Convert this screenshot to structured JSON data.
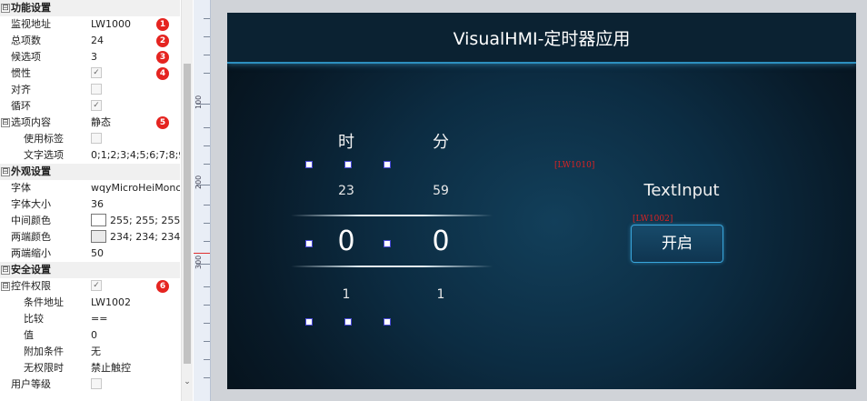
{
  "properties": {
    "sections": {
      "function": "功能设置",
      "appearance": "外观设置",
      "security": "安全设置"
    },
    "rows": {
      "monitor_address": {
        "label": "监视地址",
        "value": "LW1000",
        "badge": "1"
      },
      "total_items": {
        "label": "总项数",
        "value": "24",
        "badge": "2"
      },
      "candidate_items": {
        "label": "候选项",
        "value": "3",
        "badge": "3"
      },
      "inertia": {
        "label": "惯性",
        "checked": "✓",
        "badge": "4"
      },
      "align": {
        "label": "对齐",
        "checked": ""
      },
      "loop": {
        "label": "循环",
        "checked": "✓"
      },
      "option_content": {
        "label": "选项内容",
        "value": "静态",
        "badge": "5"
      },
      "use_label": {
        "label": "使用标签",
        "checked": ""
      },
      "text_options": {
        "label": "文字选项",
        "value": "0;1;2;3;4;5;6;7;8;9;10"
      },
      "font": {
        "label": "字体",
        "value": "wqyMicroHeiMono"
      },
      "font_size": {
        "label": "字体大小",
        "value": "36"
      },
      "middle_color": {
        "label": "中间颜色",
        "value": "255; 255; 255",
        "color": "#ffffff"
      },
      "edge_color": {
        "label": "两端颜色",
        "value": "234; 234; 234",
        "color": "#eaeaea"
      },
      "edge_shrink": {
        "label": "两端缩小",
        "value": "50"
      },
      "control_permission": {
        "label": "控件权限",
        "checked": "✓",
        "badge": "6"
      },
      "condition_address": {
        "label": "条件地址",
        "value": "LW1002"
      },
      "compare": {
        "label": "比较",
        "value": "=="
      },
      "cmp_value": {
        "label": "值",
        "value": "0"
      },
      "extra_condition": {
        "label": "附加条件",
        "value": "无"
      },
      "no_permission": {
        "label": "无权限时",
        "value": "禁止触控"
      },
      "user_level": {
        "label": "用户等级",
        "checked": ""
      }
    },
    "expander_minus": "⊟",
    "scroll_down": "⌄"
  },
  "ruler": {
    "labels": [
      "100",
      "200",
      "300"
    ]
  },
  "hmi": {
    "title": "VisualHMI-定时器应用",
    "hour_header": "时",
    "minute_header": "分",
    "hour_above": "23",
    "minute_above": "59",
    "hour_current": "0",
    "minute_current": "0",
    "hour_below": "1",
    "minute_below": "1",
    "addr_label_1": "[LW1010]",
    "addr_label_2": "[LW1002]",
    "text_input": "TextInput",
    "start_button": "开启"
  },
  "colors": {
    "badge": "#e52420",
    "title_bar_border": "#2d8fbf",
    "screen_bg": "#0c2c42",
    "button_border": "#39a6dc",
    "address_label": "#dd2222"
  }
}
